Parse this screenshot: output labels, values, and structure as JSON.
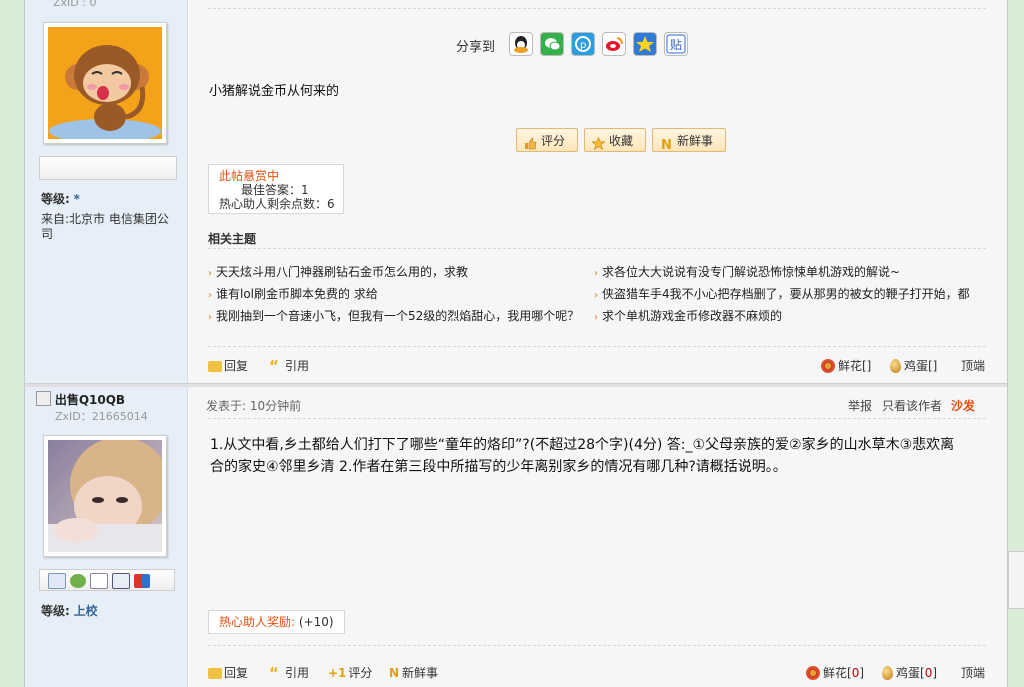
{
  "post1": {
    "user": {
      "zxid": "ZxID : 0",
      "level_label": "等级:",
      "level_value": "*",
      "from": "来自:北京市 电信集团公司"
    },
    "share_label": "分享到",
    "share_icons": [
      "qq-icon",
      "wechat-icon",
      "qzone-icon",
      "weibo-icon",
      "star-icon",
      "tieba-icon"
    ],
    "content": "小猪解说金币从何来的",
    "actions": {
      "rate": "评分",
      "favorite": "收藏",
      "fresh": "新鲜事"
    },
    "bounty": {
      "title": "此帖悬赏中",
      "best": "最佳答案：1",
      "remaining": "热心助人剩余点数：6"
    },
    "related": {
      "title": "相关主题",
      "items": [
        "天天炫斗用八门神器刷钻石金币怎么用的，求教",
        "求各位大大说说有没专门解说恐怖惊悚单机游戏的解说~",
        "谁有lol刷金币脚本免费的 求给",
        "侠盗猎车手4我不小心把存档删了，要从那男的被女的鞭子打开始，都",
        "我刚抽到一个音速小飞，但我有一个52级的烈焰甜心，我用哪个呢？",
        "求个单机游戏金币修改器不麻烦的"
      ]
    },
    "footer": {
      "reply": "回复",
      "quote": "引用",
      "flower": "鲜花[]",
      "egg": "鸡蛋[]",
      "top": "顶端"
    }
  },
  "post2": {
    "user": {
      "name": "出售Q10QB",
      "zxid": "ZxID：21665014",
      "level_label": "等级:",
      "level_value": "上校"
    },
    "header": {
      "time": "发表于: 10分钟前",
      "report": "举报",
      "only_author": "只看该作者",
      "floor": "沙发"
    },
    "content": "1.从文中看,乡土都给人们打下了哪些“童年的烙印”?(不超过28个字)(4分) 答:_①父母亲族的爱②家乡的山水草木③悲欢离合的家史④邻里乡清 2.作者在第三段中所描写的少年离别家乡的情况有哪几种?请概括说明。。",
    "reward": {
      "label": "热心助人奖励:",
      "value": "(+10)"
    },
    "footer": {
      "reply": "回复",
      "quote": "引用",
      "rate": "评分",
      "fresh": "新鲜事",
      "flower": "鲜花[",
      "flower_count": "0",
      "egg": "鸡蛋[",
      "egg_count": "0",
      "close": "]",
      "top": "顶端"
    }
  }
}
